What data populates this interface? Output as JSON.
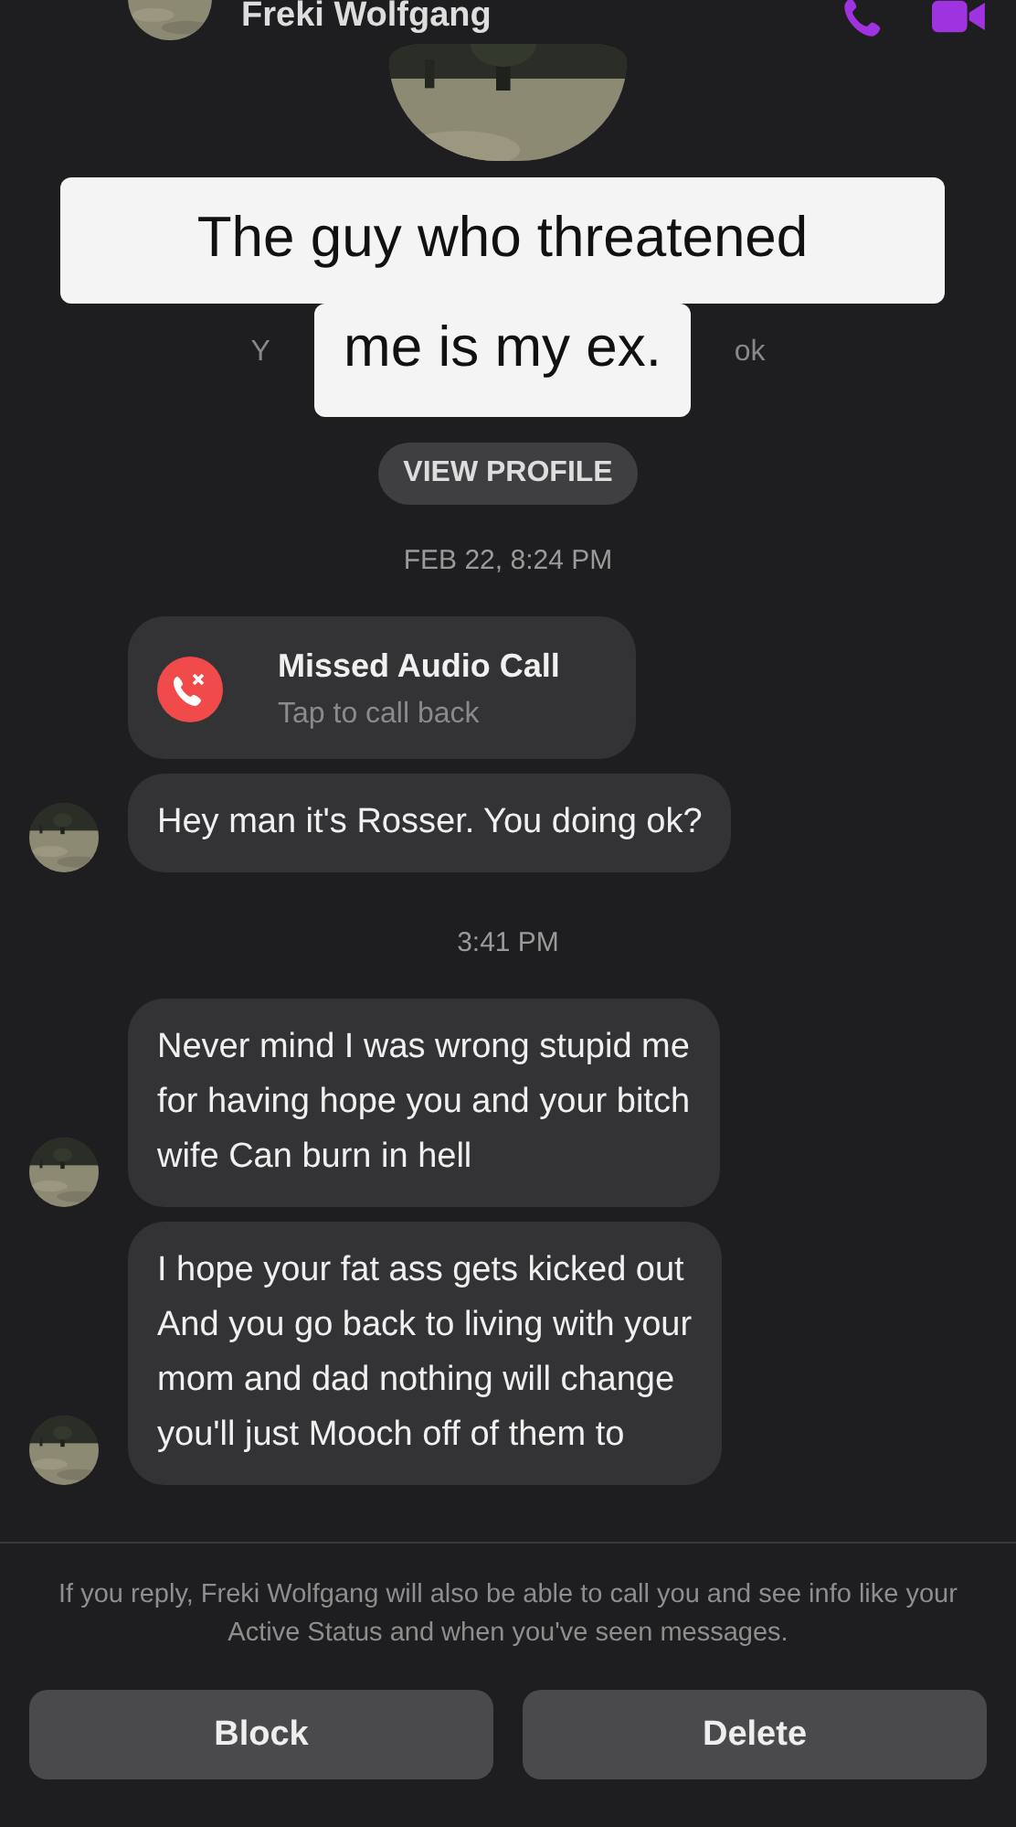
{
  "header": {
    "name": "Freki Wolfgang"
  },
  "caption": {
    "lines": [
      "The guy who threatened",
      "me is my ex."
    ]
  },
  "profile": {
    "subtitle_left": "Y",
    "subtitle_right": "ok",
    "button": "VIEW PROFILE"
  },
  "messages": [
    {
      "kind": "timestamp",
      "text": "FEB 22, 8:24 PM"
    },
    {
      "kind": "call",
      "title": "Missed Audio Call",
      "subtitle": "Tap to call back",
      "avatar": false
    },
    {
      "kind": "text",
      "text": "Hey man it's Rosser. You doing ok?",
      "avatar": true
    },
    {
      "kind": "timestamp",
      "text": "3:41 PM"
    },
    {
      "kind": "text",
      "text": "Never mind I was wrong stupid me\nfor having hope you and your bitch\nwife  Can burn in hell",
      "avatar": true
    },
    {
      "kind": "text",
      "text": "I hope your fat ass gets kicked out\nAnd you go back to living with your\nmom and dad nothing will change\nyou'll just Mooch off of them to",
      "avatar": true
    }
  ],
  "notice": "If you reply, Freki Wolfgang will also be able to call you and see info like your Active Status and when you've seen messages.",
  "buttons": [
    "Block",
    "Delete"
  ]
}
